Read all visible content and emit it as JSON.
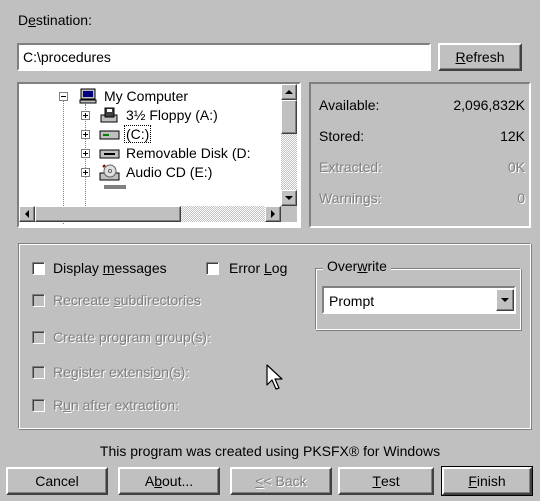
{
  "destination": {
    "label_pre": "D",
    "label_u": "e",
    "label_post": "stination:",
    "value": "C:\\procedures",
    "refresh_u": "R",
    "refresh_post": "efresh"
  },
  "tree": {
    "items": [
      {
        "label": "My Computer",
        "icon": "computer-icon"
      },
      {
        "label": "3½ Floppy (A:)",
        "icon": "floppy-drive-icon"
      },
      {
        "label": "(C:)",
        "icon": "hard-drive-icon"
      },
      {
        "label": "Removable Disk (D:",
        "icon": "removable-disk-icon"
      },
      {
        "label": "Audio CD (E:)",
        "icon": "cd-drive-icon"
      }
    ]
  },
  "stats": {
    "available_label": "Available:",
    "available_value": "2,096,832K",
    "stored_label": "Stored:",
    "stored_value": "12K",
    "extracted_label": "Extracted:",
    "extracted_value": "0K",
    "warnings_label": "Warnings:",
    "warnings_value": "0"
  },
  "options": {
    "display_messages_pre": "Display ",
    "display_messages_u": "m",
    "display_messages_post": "essages",
    "error_log_pre": "Error ",
    "error_log_u": "L",
    "error_log_post": "og",
    "recreate_pre": "Recreate ",
    "recreate_u": "s",
    "recreate_post": "ubdirectories",
    "create_group_pre": "Create program ",
    "create_group_u": "g",
    "create_group_post": "roup(s):",
    "register_pre": "Register extensi",
    "register_u": "o",
    "register_post": "n(s):",
    "run_pre": "R",
    "run_u": "u",
    "run_post": "n after extraction:"
  },
  "overwrite": {
    "label_pre": "Over",
    "label_u": "w",
    "label_post": "rite",
    "selected": "Prompt"
  },
  "footer": {
    "credit": "This program was created using PKSFX® for Windows"
  },
  "buttons": {
    "cancel": "Cancel",
    "about_pre": "A",
    "about_u": "b",
    "about_post": "out...",
    "back_u": "<",
    "back_post": "< Back",
    "test_u": "T",
    "test_post": "est",
    "finish_u": "F",
    "finish_post": "inish"
  }
}
